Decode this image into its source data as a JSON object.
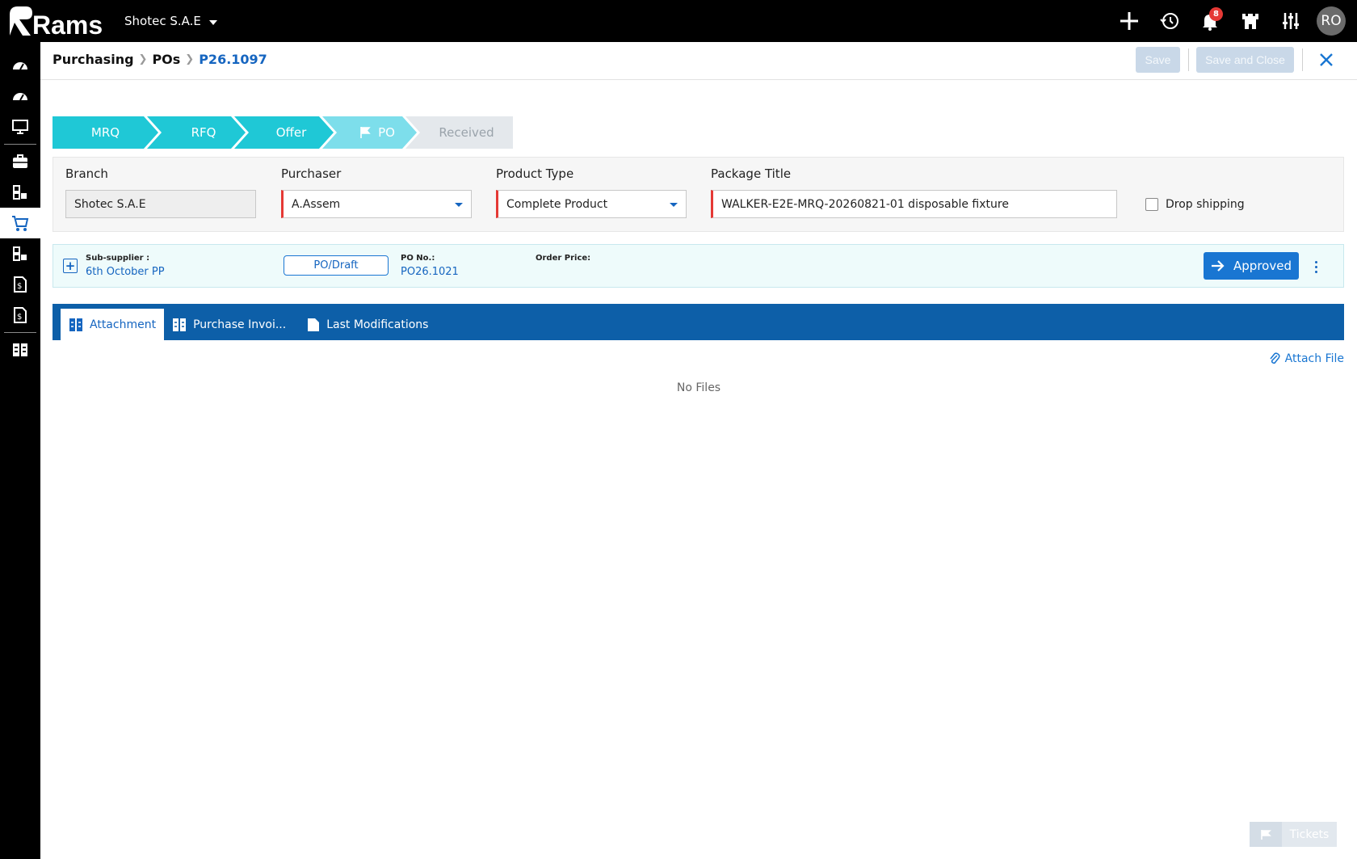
{
  "app": {
    "logo_text": "Rams",
    "company": "Shotec S.A.E",
    "notifications_count": "8",
    "user_initials": "RO"
  },
  "breadcrumb": [
    "Purchasing",
    "POs",
    "P26.1097"
  ],
  "header": {
    "save_label": "Save",
    "save_close_label": "Save and Close"
  },
  "stepper": [
    {
      "label": "MRQ",
      "state": "done"
    },
    {
      "label": "RFQ",
      "state": "done"
    },
    {
      "label": "Offer",
      "state": "done"
    },
    {
      "label": "PO",
      "state": "current"
    },
    {
      "label": "Received",
      "state": "pending"
    }
  ],
  "form": {
    "branch_label": "Branch",
    "branch_value": "Shotec S.A.E",
    "purchaser_label": "Purchaser",
    "purchaser_value": "A.Assem",
    "product_type_label": "Product Type",
    "product_type_value": "Complete Product",
    "package_title_label": "Package Title",
    "package_title_value": "WALKER-E2E-MRQ-20260821-01 disposable fixture",
    "drop_shipping_label": "Drop shipping"
  },
  "supplier": {
    "sub_supplier_label": "Sub-supplier :",
    "sub_supplier_value": "6th October PP",
    "status": "PO/Draft",
    "po_no_label": "PO No.:",
    "po_no_value": "PO26.1021",
    "order_price_label": "Order Price:",
    "approved_label": "Approved"
  },
  "tabs": [
    {
      "label": "Attachment",
      "active": true
    },
    {
      "label": "Purchase Invoi...",
      "active": false
    },
    {
      "label": "Last Modifications",
      "active": false
    }
  ],
  "attachments": {
    "attach_label": "Attach File",
    "empty_label": "No Files"
  },
  "tickets_label": "Tickets",
  "colors": {
    "accent": "#1976d2",
    "step_done": "#1fc8d6",
    "step_current": "#7ddeeb",
    "step_pending": "#e4e8ec",
    "tab_bar": "#0d5fa8"
  }
}
